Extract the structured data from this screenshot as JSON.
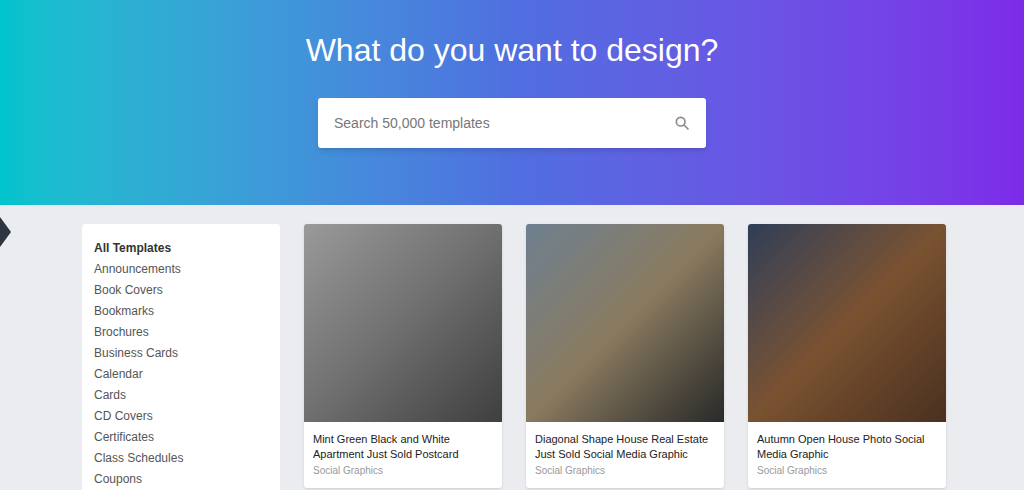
{
  "hero": {
    "title": "What do you want to design?"
  },
  "search": {
    "placeholder": "Search 50,000 templates"
  },
  "sidebar": {
    "items": [
      {
        "label": "All Templates",
        "selected": true
      },
      {
        "label": "Announcements",
        "selected": false
      },
      {
        "label": "Book Covers",
        "selected": false
      },
      {
        "label": "Bookmarks",
        "selected": false
      },
      {
        "label": "Brochures",
        "selected": false
      },
      {
        "label": "Business Cards",
        "selected": false
      },
      {
        "label": "Calendar",
        "selected": false
      },
      {
        "label": "Cards",
        "selected": false
      },
      {
        "label": "CD Covers",
        "selected": false
      },
      {
        "label": "Certificates",
        "selected": false
      },
      {
        "label": "Class Schedules",
        "selected": false
      },
      {
        "label": "Coupons",
        "selected": false
      }
    ]
  },
  "cards": [
    {
      "title": "Mint Green Black and White Apartment Just Sold Postcard",
      "category": "Social Graphics"
    },
    {
      "title": "Diagonal Shape House Real Estate Just Sold Social Media Graphic",
      "category": "Social Graphics"
    },
    {
      "title": "Autumn Open House Photo Social Media Graphic",
      "category": "Social Graphics"
    }
  ]
}
